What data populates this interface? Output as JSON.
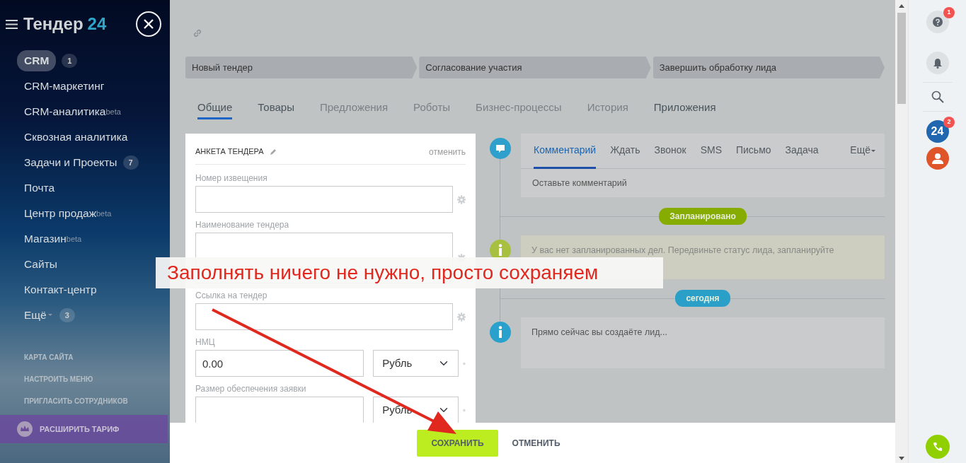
{
  "sidebar": {
    "logo": {
      "name": "Тендер",
      "number": "24"
    },
    "items": [
      {
        "label": "CRM",
        "selected": true,
        "counter": "1"
      },
      {
        "label": "CRM-маркетинг",
        "selected": false
      },
      {
        "label": "CRM-аналитика",
        "sup": "beta",
        "selected": false
      },
      {
        "label": "Сквозная аналитика",
        "selected": false
      },
      {
        "label": "Задачи и Проекты",
        "counter": "7",
        "selected": false
      },
      {
        "label": "Почта",
        "selected": false
      },
      {
        "label": "Центр продаж",
        "sup": "beta",
        "selected": false
      },
      {
        "label": "Магазин",
        "sup": "beta",
        "selected": false
      },
      {
        "label": "Сайты",
        "selected": false
      },
      {
        "label": "Контакт-центр",
        "selected": false
      },
      {
        "label": "Ещё",
        "has_menu": true,
        "counter": "3",
        "selected": false
      }
    ],
    "links": [
      "КАРТА САЙТА",
      "НАСТРОИТЬ МЕНЮ",
      "ПРИГЛАСИТЬ СОТРУДНИКОВ"
    ],
    "upgrade": "РАСШИРИТЬ ТАРИФ"
  },
  "stages": [
    "Новый тендер",
    "Согласование участия",
    "Завершить обработку лида"
  ],
  "tabs": [
    {
      "label": "Общие",
      "selected": true,
      "disabled": false
    },
    {
      "label": "Товары",
      "selected": false,
      "disabled": false
    },
    {
      "label": "Предложения",
      "selected": false,
      "disabled": true
    },
    {
      "label": "Роботы",
      "selected": false,
      "disabled": true
    },
    {
      "label": "Бизнес-процессы",
      "selected": false,
      "disabled": true
    },
    {
      "label": "История",
      "selected": false,
      "disabled": true
    },
    {
      "label": "Приложения",
      "selected": false,
      "disabled": false
    }
  ],
  "form": {
    "title": "АНКЕТА ТЕНДЕРА",
    "cancel": "отменить",
    "fields": [
      {
        "kind": "input",
        "label": "Номер извещения"
      },
      {
        "kind": "textarea",
        "label": "Наименование тендера"
      },
      {
        "kind": "input",
        "label": "Ссылка на тендер"
      },
      {
        "kind": "money",
        "label": "НМЦ",
        "value": "0.00",
        "currency": "Рубль"
      },
      {
        "kind": "money",
        "label": "Размер обеспечения заявки",
        "currency": "Рубль"
      }
    ]
  },
  "timeline": {
    "composer": {
      "tabs": [
        {
          "label": "Комментарий",
          "selected": true
        },
        {
          "label": "Ждать",
          "selected": false
        },
        {
          "label": "Звонок",
          "selected": false
        },
        {
          "label": "SMS",
          "selected": false
        },
        {
          "label": "Письмо",
          "selected": false
        },
        {
          "label": "Задача",
          "selected": false
        }
      ],
      "more": "Ещё",
      "placeholder": "Оставьте комментарий"
    },
    "entries": [
      {
        "kind": "divider",
        "label": "Запланировано",
        "color": "#86ac00"
      },
      {
        "kind": "note",
        "text": "У вас нет запланированных дел. Передвиньте статус лида, запланируйте",
        "color": "#a8c040",
        "highlighted": true
      },
      {
        "kind": "divider",
        "label": "сегодня",
        "color": "#2aa0c8"
      },
      {
        "kind": "note",
        "text": "Прямо сейчас вы создаёте лид...",
        "color": "#2aa0cc",
        "highlighted": false
      }
    ]
  },
  "footer": {
    "save": "СОХРАНИТЬ",
    "cancel": "ОТМЕНИТЬ"
  },
  "rightbar": {
    "help_badge": "1",
    "apps_label": "24",
    "apps_badge": "2"
  },
  "annotation": "Заполнять ничего не нужно, просто сохраняем"
}
